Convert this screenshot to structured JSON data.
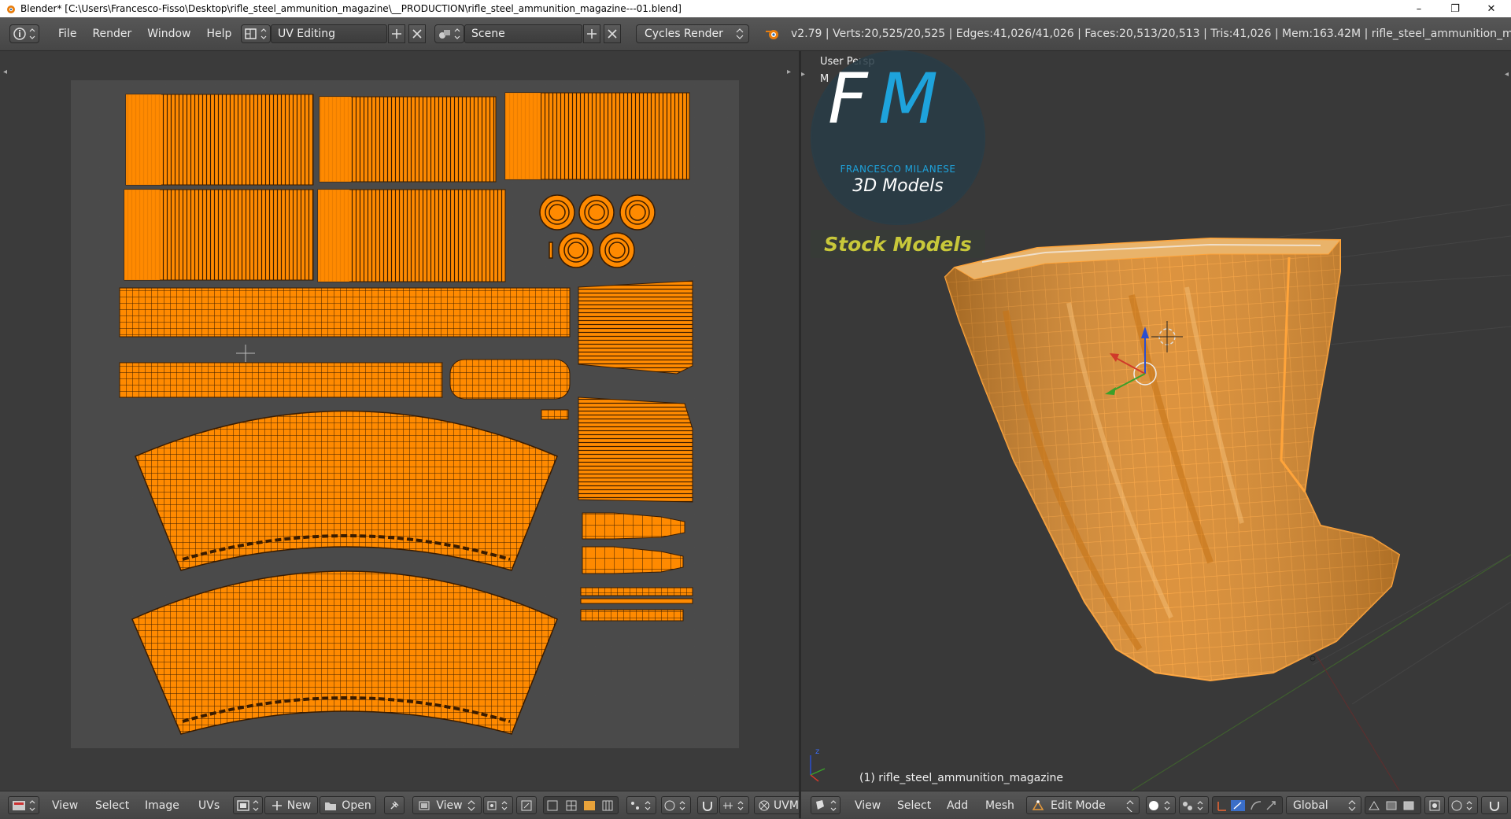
{
  "window": {
    "title": "Blender* [C:\\Users\\Francesco-Fisso\\Desktop\\rifle_steel_ammunition_magazine\\__PRODUCTION\\rifle_steel_ammunition_magazine---01.blend]",
    "minimize": "–",
    "restore": "❐",
    "close": "✕"
  },
  "menubar": {
    "items": [
      "File",
      "Render",
      "Window",
      "Help"
    ],
    "layout_name": "UV Editing",
    "scene_name": "Scene",
    "render_engine": "Cycles Render",
    "stats": "v2.79 | Verts:20,525/20,525 | Edges:41,026/41,026 | Faces:20,513/20,513 | Tris:41,026 | Mem:163.42M | rifle_steel_ammunition_magazine"
  },
  "uv_editor": {
    "menus": [
      "View",
      "Select",
      "Image",
      "UVs"
    ],
    "new_label": "New",
    "open_label": "Open",
    "view_label": "View",
    "uvmap_label": "UVM"
  },
  "viewport": {
    "view_name": "User Persp",
    "sub_label": "M",
    "object_label": "(1) rifle_steel_ammunition_magazine",
    "menus": [
      "View",
      "Select",
      "Add",
      "Mesh"
    ],
    "mode": "Edit Mode",
    "orientation": "Global"
  },
  "watermark": {
    "logo_letters_f": "F",
    "logo_letters_m": "M",
    "author": "FRANCESCO MILANESE",
    "subtitle": "3D Models",
    "badge": "Stock Models"
  },
  "colors": {
    "uv_orange": "#ff8a00",
    "uv_line": "#3a1c00",
    "mesh_orange": "#f7a23a",
    "blue_logo": "#1ea3dc"
  }
}
